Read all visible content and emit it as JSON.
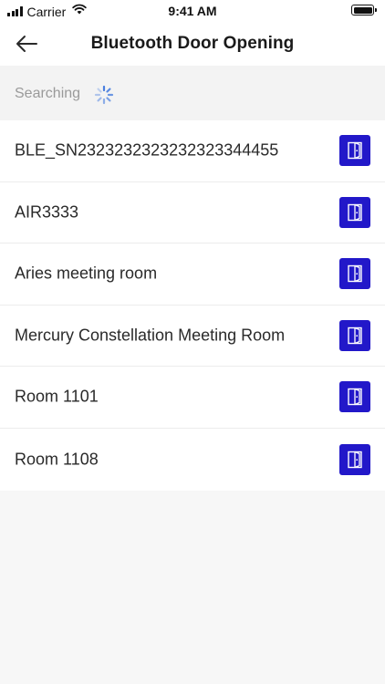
{
  "status_bar": {
    "carrier": "Carrier",
    "time": "9:41 AM",
    "signal_icon": "signal-bars-icon",
    "wifi_icon": "wifi-icon",
    "battery_icon": "battery-icon"
  },
  "nav": {
    "title": "Bluetooth Door Opening",
    "back_icon": "arrow-left-icon"
  },
  "search": {
    "label": "Searching",
    "spinner_icon": "loading-spinner-icon"
  },
  "devices": [
    {
      "name": "BLE_SN2323232323232323344455",
      "action_icon": "door-icon"
    },
    {
      "name": "AIR3333",
      "action_icon": "door-icon"
    },
    {
      "name": "Aries meeting room",
      "action_icon": "door-icon"
    },
    {
      "name": "Mercury Constellation Meeting Room",
      "action_icon": "door-icon"
    },
    {
      "name": "Room 1101",
      "action_icon": "door-icon"
    },
    {
      "name": "Room 1108",
      "action_icon": "door-icon"
    }
  ],
  "colors": {
    "accent": "#2218c9",
    "spinner": "#4a7fe0",
    "background": "#f7f7f7",
    "muted_text": "#9a9a9a"
  }
}
